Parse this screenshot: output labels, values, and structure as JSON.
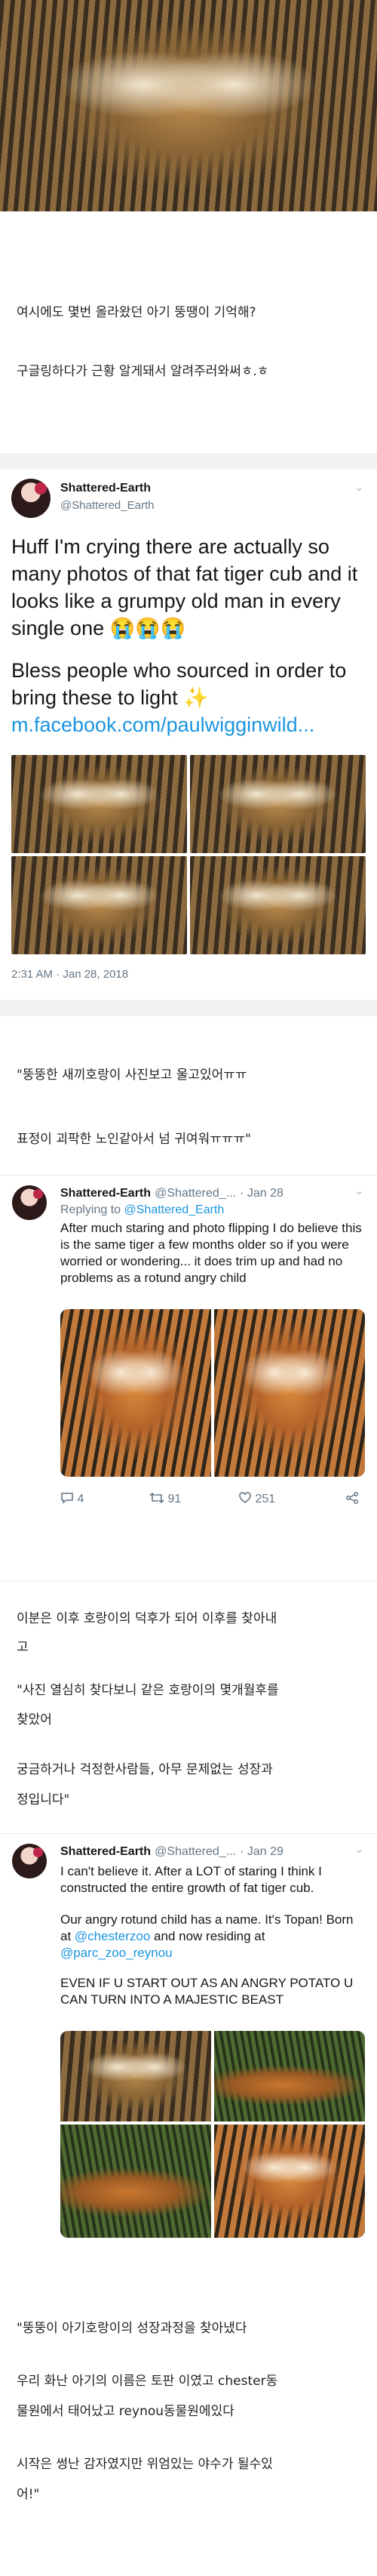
{
  "intro": {
    "line1": "여시에도 몇번 올라왔던 아기 뚱땡이 기억해?",
    "line2": "구글링하다가 근황 알게돼서 알려주러와써ㅎ.ㅎ"
  },
  "tweet1": {
    "name": "Shattered-Earth",
    "handle": "@Shattered_Earth",
    "text1": "Huff I'm crying there are actually so many photos of that fat tiger cub and it looks like a grumpy old man in every single one 😭😭😭",
    "text2": "Bless people who sourced in order to bring these to light ✨",
    "link": "m.facebook.com/paulwigginwild...",
    "timestamp": "2:31 AM · Jan 28, 2018"
  },
  "caption1": {
    "line1": "\"뚱뚱한 새끼호랑이 사진보고 울고있어ㅠㅠ",
    "line2": "표정이 괴팍한 노인같아서 넘 귀여워ㅠㅠㅠ\""
  },
  "tweet2": {
    "name": "Shattered-Earth",
    "handle": "@Shattered_...",
    "date": "· Jan 28",
    "reply_prefix": "Replying to ",
    "reply_handle": "@Shattered_Earth",
    "text": "After much staring and photo flipping I do believe this is the same tiger a few months older so if you were worried or wondering... it does trim up and had no problems as a rotund angry child",
    "replies": "4",
    "retweets": "91",
    "likes": "251"
  },
  "caption2": {
    "line1": "이분은 이후 호랑이의 덕후가 되어 이후를 찾아내",
    "line2": "고"
  },
  "caption3": {
    "line1": "\"사진 열심히 찾다보니 같은 호랑이의 몇개월후를",
    "line2": "찾았어",
    "line3": "궁금하거나 걱정한사람들, 아무 문제없는 성장과",
    "line4": "정입니다\""
  },
  "tweet3": {
    "name": "Shattered-Earth",
    "handle": "@Shattered_...",
    "date": "· Jan 29",
    "text1": "I can't believe it. After a LOT of staring I think I constructed the entire growth of fat tiger cub.",
    "text2a": "Our angry rotund child has a name. It's Topan! Born at ",
    "mention1": "@chesterzoo",
    "text2b": " and now residing at ",
    "mention2": "@parc_zoo_reynou",
    "text3": "EVEN IF U START OUT AS AN ANGRY POTATO U CAN TURN INTO A MAJESTIC BEAST"
  },
  "caption4": {
    "line1": "\"뚱뚱이 아기호랑이의 성장과정을 찾아냈다",
    "line2": "우리 화난 아기의 이름은 토판 이였고 chester동",
    "line3": "물원에서 태어났고 reynou동물원에있다",
    "line4": "시작은 썽난 감자였지만 위엄있는 야수가 될수있",
    "line5": "어!\""
  },
  "icons": {
    "chevron": "chevron-down-icon",
    "reply": "reply-icon",
    "retweet": "retweet-icon",
    "like": "heart-icon",
    "share": "share-icon"
  },
  "colors": {
    "link": "#1b95e0",
    "text": "#14171a",
    "muted": "#657786"
  }
}
